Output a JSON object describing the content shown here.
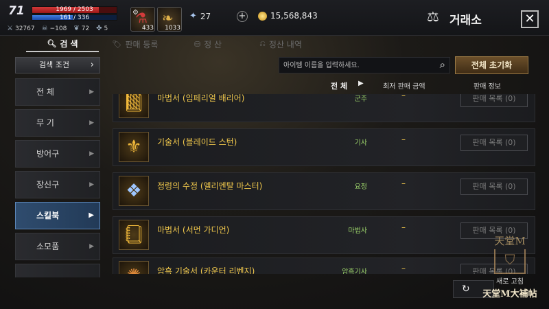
{
  "player": {
    "level": "71",
    "hp_text": "1969 / 2503",
    "hp_ratio": 0.787,
    "mp_text": "161 / 336",
    "mp_ratio": 0.479,
    "stats": [
      {
        "icon": "combat-power-icon",
        "value": "32767"
      },
      {
        "icon": "skull-icon",
        "value": "−108"
      },
      {
        "icon": "wing-icon",
        "value": "72"
      },
      {
        "icon": "pet-icon",
        "value": "5"
      }
    ]
  },
  "inventory_slots": [
    {
      "icon": "potion-icon",
      "count": "433"
    },
    {
      "icon": "feather-icon",
      "count": "1033"
    }
  ],
  "currency": {
    "diamond": "27",
    "adena": "15,568,843"
  },
  "page": {
    "title": "거래소"
  },
  "tabs": [
    {
      "label": "검 색",
      "icon": "search-icon",
      "active": true
    },
    {
      "label": "판매 등록",
      "icon": "tag-icon",
      "active": false
    },
    {
      "label": "정 산",
      "icon": "coins-icon",
      "active": false
    },
    {
      "label": "정산 내역",
      "icon": "history-icon",
      "active": false
    }
  ],
  "search": {
    "condition_label": "검색 조건",
    "placeholder": "아이템 이름을 입력하세요.",
    "reset_label": "전체 초기화"
  },
  "categories": [
    {
      "label": "전 체",
      "active": false
    },
    {
      "label": "무 기",
      "active": false
    },
    {
      "label": "방어구",
      "active": false
    },
    {
      "label": "장신구",
      "active": false
    },
    {
      "label": "스킬북",
      "active": true
    },
    {
      "label": "소모품",
      "active": false
    },
    {
      "label": "",
      "active": false
    }
  ],
  "list_header": {
    "filter_label": "전 체",
    "price_label": "최저 판매 금액",
    "info_label": "판매 정보"
  },
  "items": [
    {
      "name": "마법서 (임페리얼 배리어)",
      "class": "군주",
      "price": "–",
      "sale": "판매 목록 (0)",
      "icon": "spellbook-icon"
    },
    {
      "name": "기술서 (블레이드 스턴)",
      "class": "기사",
      "price": "–",
      "sale": "판매 목록 (0)",
      "icon": "skillbook-icon"
    },
    {
      "name": "정령의 수정 (엘리멘탈 마스터)",
      "class": "요정",
      "price": "–",
      "sale": "판매 목록 (0)",
      "icon": "crystal-icon"
    },
    {
      "name": "마법서 (서먼 가디언)",
      "class": "마법사",
      "price": "–",
      "sale": "판매 목록 (0)",
      "icon": "spellbook-icon"
    },
    {
      "name": "암흑 기술서 (카운터 리벤지)",
      "class": "암흑기사",
      "price": "–",
      "sale": "판매 목록 (0)",
      "icon": "dark-skillbook-icon"
    }
  ],
  "bottom": {
    "refresh_label": "↻"
  },
  "watermark": {
    "top": "天堂M",
    "sub": "새로 고침",
    "bottom": "天堂M大補帖"
  }
}
